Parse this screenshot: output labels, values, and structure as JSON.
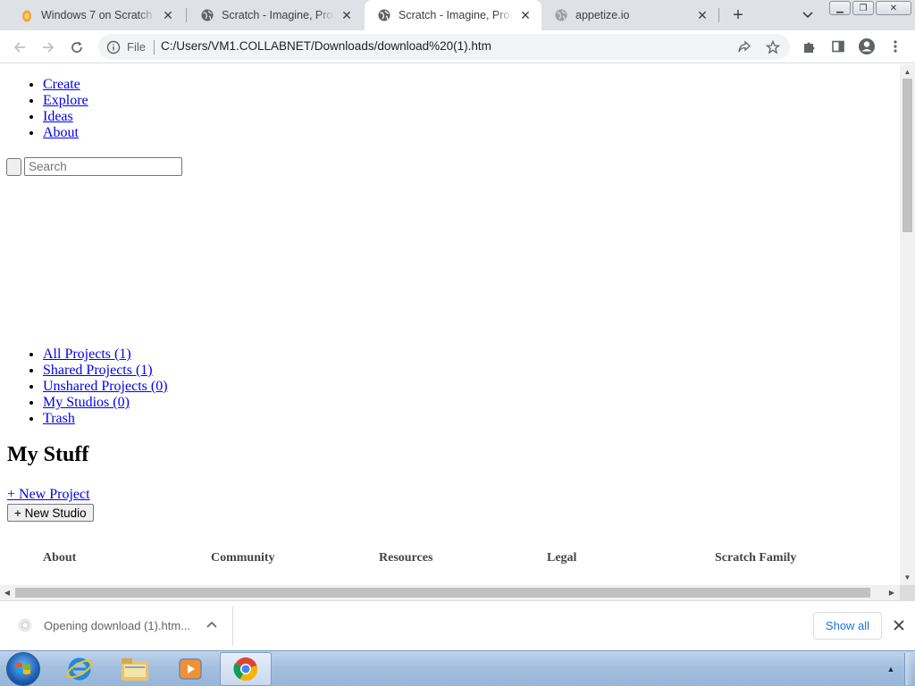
{
  "browser": {
    "tabs": [
      {
        "title": "Windows 7 on Scratch",
        "favicon": "scratch-cat-icon",
        "active": false
      },
      {
        "title": "Scratch - Imagine, Program",
        "favicon": "globe-icon",
        "active": false
      },
      {
        "title": "Scratch - Imagine, Program",
        "favicon": "globe-icon",
        "active": true
      },
      {
        "title": "appetize.io",
        "favicon": "globe-icon",
        "active": false
      }
    ],
    "new_tab_label": "+",
    "address": {
      "scheme_label": "File",
      "url": "C:/Users/VM1.COLLABNET/Downloads/download%20(1).htm"
    }
  },
  "page": {
    "nav_links": [
      "Create",
      "Explore",
      "Ideas",
      "About"
    ],
    "search": {
      "placeholder": "Search",
      "value": ""
    },
    "stuff_links": [
      "All Projects (1)",
      "Shared Projects (1)",
      "Unshared Projects (0)",
      "My Studios (0)",
      "Trash"
    ],
    "heading": "My Stuff",
    "new_project_label": "+ New Project",
    "new_studio_label": "+ New Studio",
    "footer_columns": [
      "About",
      "Community",
      "Resources",
      "Legal",
      "Scratch Family"
    ]
  },
  "download_shelf": {
    "item_label": "Opening download (1).htm...",
    "show_all_label": "Show all"
  },
  "taskbar": {
    "apps": [
      "internet-explorer-icon",
      "file-explorer-icon",
      "media-player-icon",
      "chrome-icon"
    ]
  },
  "colors": {
    "link": "#0000ee",
    "show_all": "#1a73e8",
    "tab_strip": "#dee1e6"
  }
}
